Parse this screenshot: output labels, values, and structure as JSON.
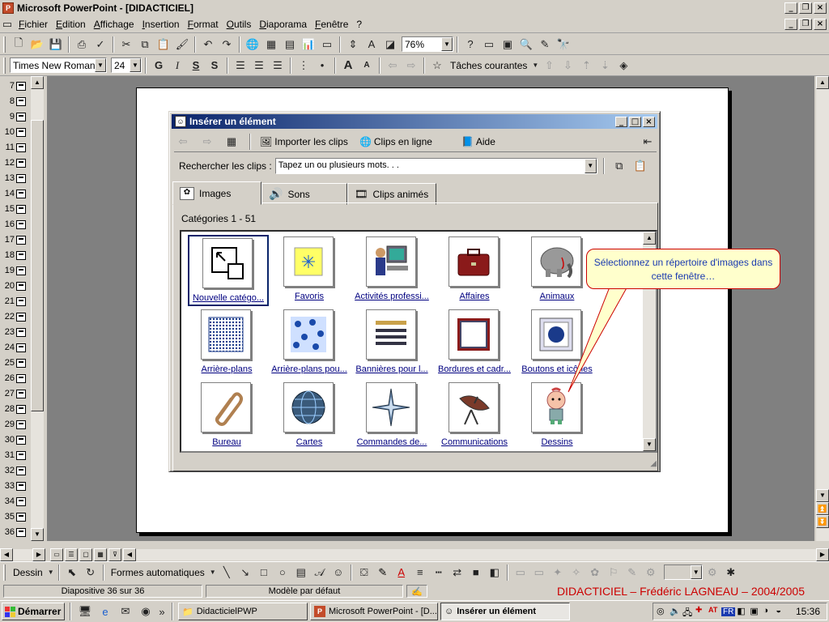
{
  "app": {
    "title": "Microsoft PowerPoint - [DIDACTICIEL]",
    "icon_letter": "P"
  },
  "menu": [
    "Fichier",
    "Edition",
    "Affichage",
    "Insertion",
    "Format",
    "Outils",
    "Diaporama",
    "Fenêtre",
    "?"
  ],
  "standard_toolbar": {
    "zoom": "76%"
  },
  "format_toolbar": {
    "font": "Times New Roman",
    "size": "24",
    "bold": "G",
    "italic": "I",
    "underline": "S",
    "shadow": "S",
    "tasks": "Tâches courantes"
  },
  "outline": {
    "slides": [
      "7",
      "8",
      "9",
      "10",
      "11",
      "12",
      "13",
      "14",
      "15",
      "16",
      "17",
      "18",
      "19",
      "20",
      "21",
      "22",
      "23",
      "24",
      "25",
      "26",
      "27",
      "28",
      "29",
      "30",
      "31",
      "32",
      "33",
      "34",
      "35",
      "36"
    ]
  },
  "dialog": {
    "title": "Insérer un élément",
    "import": "Importer les clips",
    "online": "Clips en ligne",
    "help": "Aide",
    "search_label": "Rechercher les clips :",
    "search_value": "Tapez un ou plusieurs mots. . .",
    "tabs": [
      "Images",
      "Sons",
      "Clips animés"
    ],
    "categories_label": "Catégories 1 - 51",
    "items": [
      {
        "label": "Nouvelle catégo...",
        "icon": "new-category-icon"
      },
      {
        "label": "Favoris",
        "icon": "favorites-star-icon"
      },
      {
        "label": "Activités professi...",
        "icon": "person-computer-icon"
      },
      {
        "label": "Affaires",
        "icon": "briefcase-icon"
      },
      {
        "label": "Animaux",
        "icon": "elephant-icon"
      },
      {
        "label": "Arrière-plans",
        "icon": "dot-grid-icon"
      },
      {
        "label": "Arrière-plans pou...",
        "icon": "flower-pattern-icon"
      },
      {
        "label": "Bannières pour l...",
        "icon": "banner-icon"
      },
      {
        "label": "Bordures et cadr...",
        "icon": "frame-icon"
      },
      {
        "label": "Boutons et icônes",
        "icon": "button-icon"
      },
      {
        "label": "Bureau",
        "icon": "paperclip-icon"
      },
      {
        "label": "Cartes",
        "icon": "globe-icon"
      },
      {
        "label": "Commandes de...",
        "icon": "compass-star-icon"
      },
      {
        "label": "Communications",
        "icon": "satellite-dish-icon"
      },
      {
        "label": "Dessins",
        "icon": "cartoon-baby-icon"
      }
    ]
  },
  "callout": {
    "text": "Sélectionnez un répertoire d'images dans cette fenêtre…"
  },
  "draw_toolbar": {
    "draw": "Dessin",
    "autoshapes": "Formes automatiques"
  },
  "status": {
    "slide": "Diapositive 36 sur 36",
    "template": "Modèle par défaut",
    "credit": "DIDACTICIEL – Frédéric LAGNEAU – 2004/2005"
  },
  "taskbar": {
    "start": "Démarrer",
    "tasks": [
      "DidacticielPWP",
      "Microsoft PowerPoint - [D...",
      "Insérer un élément"
    ],
    "lang": "FR",
    "clock": "15:36"
  },
  "colors": {
    "accent": "#0a246a",
    "credit": "#cc0000",
    "callout_text": "#1a3ab0",
    "link": "#000080"
  }
}
